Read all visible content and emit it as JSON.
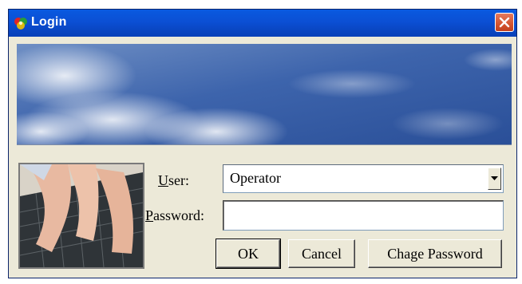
{
  "window": {
    "title": "Login",
    "close_label": "✕"
  },
  "form": {
    "user_label_key": "U",
    "user_label_rest": "ser:",
    "user_value": "Operator",
    "password_label_key": "P",
    "password_label_rest": "assword:",
    "password_value": ""
  },
  "buttons": {
    "ok": "OK",
    "cancel": "Cancel",
    "change_password": "Chage Password"
  },
  "colors": {
    "titlebar": "#0b4fd4",
    "dialog_bg": "#ece9d8",
    "close_button": "#d4542f"
  },
  "icons": {
    "app": "app-logo-icon",
    "close": "close-icon",
    "dropdown": "chevron-down-icon"
  }
}
